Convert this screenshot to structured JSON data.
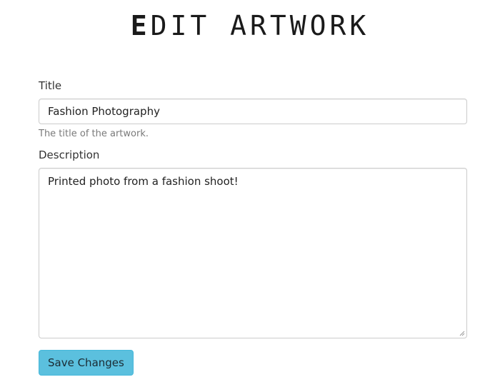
{
  "header": {
    "title_first_letter": "E",
    "title_rest": "DIT ARTWORK"
  },
  "form": {
    "title_label": "Title",
    "title_value": "Fashion Photography",
    "title_help": "The title of the artwork.",
    "description_label": "Description",
    "description_value": "Printed photo from a fashion shoot!",
    "save_label": "Save Changes"
  },
  "colors": {
    "button_background": "#5bc0de",
    "input_border": "#cccccc",
    "help_text": "#7a7a7a"
  }
}
